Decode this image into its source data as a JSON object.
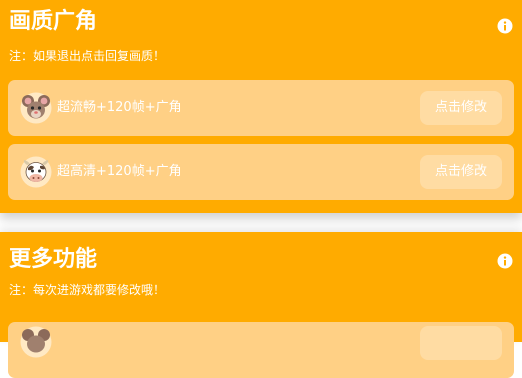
{
  "colors": {
    "card_background": "#FFAB00",
    "row_background": "#FFD085",
    "button_background": "#FFDCA3",
    "text": "#FFFFFF"
  },
  "quality_section": {
    "title": "画质广角",
    "note": "注：如果退出点击回复画质！",
    "info_icon": "info-icon",
    "options": [
      {
        "icon": "mouse-icon",
        "label": "超流畅+120帧+广角",
        "button": "点击修改"
      },
      {
        "icon": "cow-icon",
        "label": "超高清+120帧+广角",
        "button": "点击修改"
      }
    ]
  },
  "more_section": {
    "title": "更多功能",
    "note": "注：每次进游戏都要修改哦！",
    "info_icon": "info-icon",
    "options": [
      {
        "icon": "mouse-icon"
      }
    ]
  }
}
